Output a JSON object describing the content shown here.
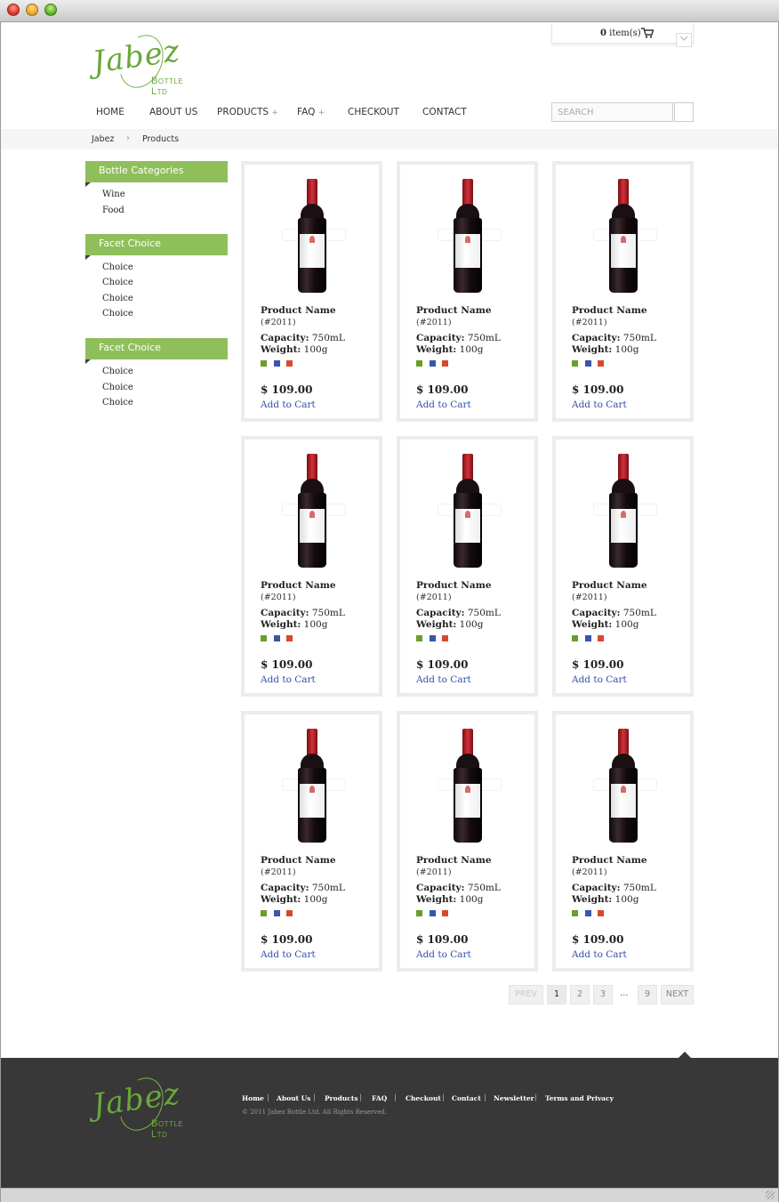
{
  "brand": {
    "script": "Jabez",
    "sub_first": "B",
    "sub_rest": "OTTLE",
    "sub_first2": "L",
    "sub_rest2": "TD"
  },
  "cart": {
    "count_num": "0",
    "count_label": "item(s)"
  },
  "nav": [
    {
      "label": "HOME",
      "plus": ""
    },
    {
      "label": "ABOUT US",
      "plus": ""
    },
    {
      "label": "PRODUCTS",
      "plus": "+"
    },
    {
      "label": "FAQ",
      "plus": "+"
    },
    {
      "label": "CHECKOUT",
      "plus": ""
    },
    {
      "label": "CONTACT",
      "plus": ""
    }
  ],
  "search": {
    "placeholder": "SEARCH"
  },
  "breadcrumb": {
    "home": "Jabez",
    "sep": "›",
    "current": "Products"
  },
  "sidebar": [
    {
      "title": "Bottle Categories",
      "items": [
        "Wine",
        "Food"
      ]
    },
    {
      "title": "Facet Choice",
      "items": [
        "Choice",
        "Choice",
        "Choice",
        "Choice"
      ]
    },
    {
      "title": "Facet Choice",
      "items": [
        "Choice",
        "Choice",
        "Choice"
      ]
    }
  ],
  "product": {
    "name": "Product Name",
    "code": "(#2011)",
    "capacity_label": "Capacity:",
    "capacity_value": "750mL",
    "weight_label": "Weight:",
    "weight_value": "100g",
    "price": "$ 109.00",
    "add_label": "Add to Cart",
    "swatches": [
      "#6a9e2a",
      "#3a56a8",
      "#d8492c"
    ]
  },
  "products_count": 9,
  "pagination": {
    "prev": "PREV",
    "pages": [
      "1",
      "2",
      "3"
    ],
    "dots": "...",
    "last": "9",
    "next": "NEXT",
    "current": "1"
  },
  "footer": {
    "links": [
      "Home",
      "About Us",
      "Products",
      "FAQ",
      "Checkout",
      "Contact",
      "Newsletter",
      "Terms and Privacy"
    ],
    "sep": "|",
    "copyright": "© 2011 Jabez Bottle Ltd. All Rights Reserved."
  },
  "colors": {
    "accent_green": "#8fbf5a",
    "logo_green": "#6aa83a",
    "link_blue": "#2f4fa8",
    "footer_bg": "#383838"
  }
}
